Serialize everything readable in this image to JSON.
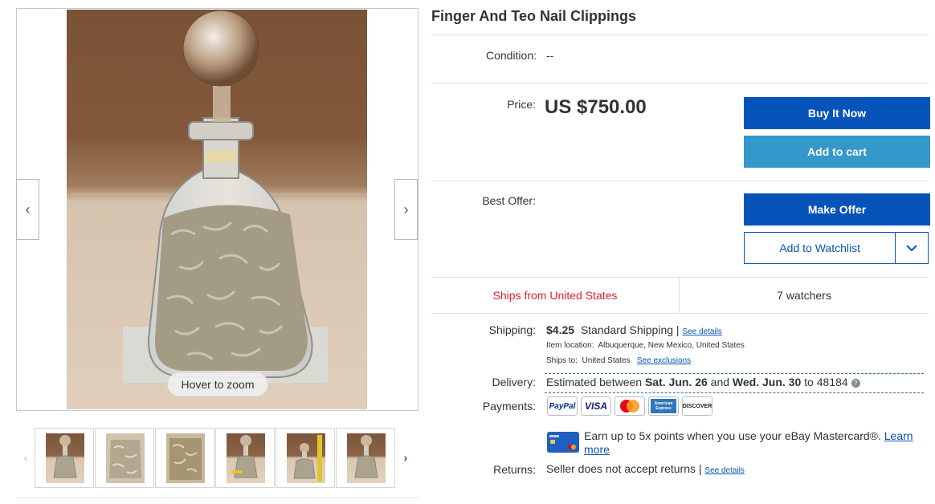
{
  "gallery": {
    "zoom_hint": "Hover to zoom",
    "prev_arrow": "‹",
    "next_arrow": "›",
    "thumb_prev": "‹",
    "thumb_next": "›",
    "thumbnail_count": 6
  },
  "item": {
    "title": "Finger And Teo Nail Clippings",
    "condition_label": "Condition:",
    "condition_value": "--",
    "price_label": "Price:",
    "price": "US $750.00",
    "best_offer_label": "Best Offer:"
  },
  "actions": {
    "buy_now": "Buy It Now",
    "add_to_cart": "Add to cart",
    "make_offer": "Make Offer",
    "add_to_watchlist": "Add to Watchlist",
    "watchlist_dropdown_icon": "chevron-down-icon"
  },
  "stats": {
    "ships_from": "Ships from United States",
    "watchers": "7 watchers"
  },
  "shipping": {
    "label": "Shipping:",
    "cost": "$4.25",
    "service": "Standard Shipping |",
    "see_details": "See details",
    "item_location_label": "Item location:",
    "item_location": "Albuquerque, New Mexico, United States",
    "ships_to_label": "Ships to:",
    "ships_to": "United States",
    "see_exclusions": "See exclusions"
  },
  "delivery": {
    "label": "Delivery:",
    "prefix": "Estimated between",
    "date_start": "Sat. Jun. 26",
    "and": "and",
    "date_end": "Wed. Jun. 30",
    "to": "to 48184",
    "help_icon": "?"
  },
  "payments": {
    "label": "Payments:",
    "methods": [
      "PayPal",
      "VISA",
      "Mastercard",
      "American Express",
      "DISCOVER"
    ],
    "mastercard_promo": "Earn up to 5x points when you use your eBay Mastercard®.",
    "learn": "Learn",
    "more": "more"
  },
  "returns": {
    "label": "Returns:",
    "policy": "Seller does not accept returns |",
    "see_details": "See details"
  },
  "colors": {
    "primary_blue": "#0654ba",
    "light_blue": "#3498ca",
    "ships_red": "#dd1e31"
  }
}
